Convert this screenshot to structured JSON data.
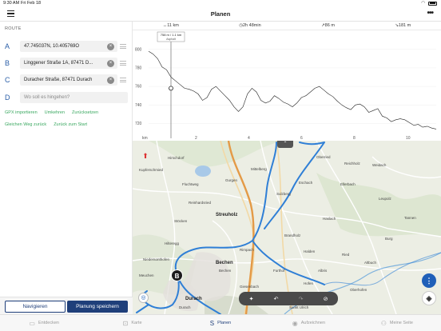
{
  "status": {
    "time": "9:30 AM",
    "date": "Fri Feb 18"
  },
  "header": {
    "title": "Planen",
    "more": "•••"
  },
  "route": {
    "heading": "ROUTE",
    "waypoints": [
      {
        "letter": "A",
        "value": "47.745037N, 10.405769O"
      },
      {
        "letter": "B",
        "value": "Linggener Straße 1A, 87471 D..."
      },
      {
        "letter": "C",
        "value": "Duracher Straße, 87471 Durach"
      }
    ],
    "next": {
      "letter": "D",
      "placeholder": "Wo soll es hingehen?"
    },
    "links_row1": [
      "GPX importieren",
      "Umkehren",
      "Zurücksetzen"
    ],
    "links_row2": [
      "Gleichen Weg zurück",
      "Zurück zum Start"
    ],
    "navigate_label": "Navigieren",
    "save_label": "Planung speichern"
  },
  "elevation": {
    "stats": [
      "↔11 km",
      "◷2h 48min",
      "↗86 m",
      "↘181 m"
    ],
    "tooltip_line1": "758 m / 1.1 km",
    "tooltip_line2": "Asphalt",
    "y_ticks": [
      "800",
      "780",
      "760",
      "740",
      "720"
    ],
    "x_ticks": [
      "km",
      "2",
      "4",
      "6",
      "8",
      "10"
    ],
    "profile": [
      798,
      795,
      790,
      781,
      778,
      770,
      766,
      762,
      758,
      757,
      755,
      752,
      745,
      748,
      757,
      760,
      755,
      750,
      745,
      738,
      733,
      738,
      752,
      758,
      754,
      745,
      742,
      744,
      750,
      747,
      743,
      741,
      738,
      742,
      748,
      750,
      754,
      758,
      760,
      756,
      752,
      749,
      744,
      740,
      737,
      735,
      740,
      741,
      738,
      732,
      734,
      736,
      728,
      726,
      722,
      724,
      725,
      724,
      721,
      718,
      719,
      716,
      717,
      715,
      714
    ]
  },
  "map": {
    "toggle": "⌃",
    "compass": "⬆",
    "marker": "B",
    "towns": [
      "Bechen",
      "Durach",
      "Streuholz"
    ],
    "places": [
      "Hirschdorf",
      "Mittelberg",
      "Fluchtweg",
      "Kupferschmied",
      "Eschach",
      "Sulzberg",
      "Hilteregg",
      "Niedersonthofen",
      "Brandholz",
      "Haslach",
      "Oberried",
      "Reichholz",
      "Weidach",
      "Ellerbach",
      "Leupolz",
      "Tannen",
      "Burg",
      "Ried",
      "Halden",
      "Gurgen",
      "Stöcken",
      "Furthof",
      "Rimpach",
      "Giesenbach",
      "Meuchen",
      "Hofen",
      "Albris",
      "Oberhofen",
      "Sankt Ulrich",
      "Bechen",
      "Reinhardsried",
      "Altbuch",
      "Durach"
    ],
    "edit_tools": [
      "✦",
      "↶",
      "↷",
      "⊘"
    ],
    "fab_more": "⋮",
    "fab_layers": "◈",
    "locate": "◎"
  },
  "tabs": [
    {
      "icon": "▭",
      "label": "Entdecken"
    },
    {
      "icon": "⊡",
      "label": "Karte"
    },
    {
      "icon": "S",
      "label": "Planen"
    },
    {
      "icon": "◉",
      "label": "Aufzeichnen"
    },
    {
      "icon": "⚇",
      "label": "Meine Seite"
    }
  ],
  "colors": {
    "route": "#2f7fd6",
    "accent": "#1f3f7a",
    "link": "#3aa860"
  }
}
